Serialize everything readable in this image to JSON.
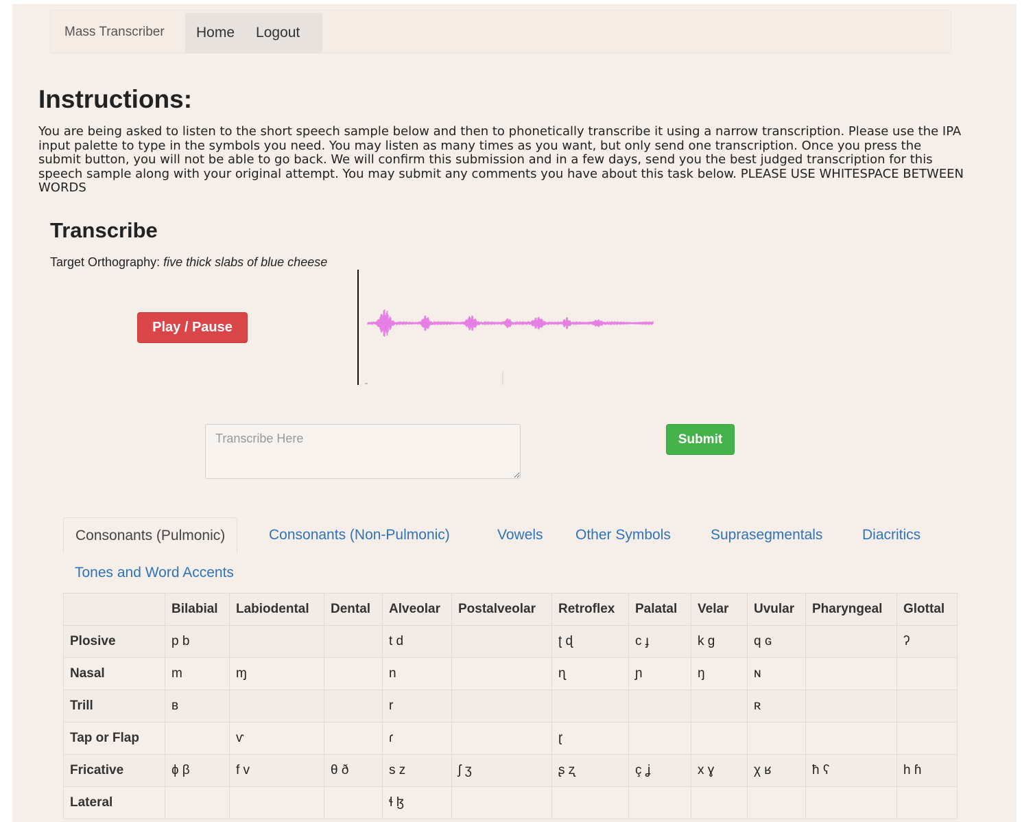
{
  "navbar": {
    "brand": "Mass Transcriber",
    "home": "Home",
    "logout": "Logout"
  },
  "instructions": {
    "heading": "Instructions:",
    "text": "You are being asked to listen to the short speech sample below and then to phonetically transcribe it using a narrow transcription. Please use the IPA input palette to type in the symbols you need. You may listen as many times as you want, but only send one transcription. Once you press the submit button, you will not be able to go back. We will confirm this submission and in a few days, send you the best judged transcription for this speech sample along with your original attempt. You may submit any comments you have about this task below. PLEASE USE WHITESPACE BETWEEN WORDS"
  },
  "transcribe": {
    "heading": "Transcribe",
    "target_label": "Target Orthography: ",
    "target_value": "five thick slabs of blue cheese",
    "play_label": "Play / Pause",
    "input_placeholder": "Transcribe Here",
    "submit_label": "Submit"
  },
  "colors": {
    "waveform": "#e57fe4",
    "play_button": "#d9464a",
    "submit_button": "#46b24b",
    "tab_link": "#2f73b8"
  },
  "tabs": [
    {
      "label": "Consonants (Pulmonic)",
      "active": true
    },
    {
      "label": "Consonants (Non-Pulmonic)",
      "active": false
    },
    {
      "label": "Vowels",
      "active": false
    },
    {
      "label": "Other Symbols",
      "active": false
    },
    {
      "label": "Suprasegmentals",
      "active": false
    },
    {
      "label": "Diacritics",
      "active": false
    },
    {
      "label": "Tones and Word Accents",
      "active": false
    }
  ],
  "ipa_table": {
    "columns": [
      "",
      "Bilabial",
      "Labiodental",
      "Dental",
      "Alveolar",
      "Postalveolar",
      "Retroflex",
      "Palatal",
      "Velar",
      "Uvular",
      "Pharyngeal",
      "Glottal"
    ],
    "rows": [
      {
        "label": "Plosive",
        "cells": [
          "p b",
          "",
          "",
          "t d",
          "",
          "ʈ ɖ",
          "c ɟ",
          "k g",
          "q ɢ",
          "",
          "ʔ"
        ]
      },
      {
        "label": "Nasal",
        "cells": [
          "m",
          "ɱ",
          "",
          "n",
          "",
          "ɳ",
          "ɲ",
          "ŋ",
          "ɴ",
          "",
          ""
        ]
      },
      {
        "label": "Trill",
        "cells": [
          "ʙ",
          "",
          "",
          "r",
          "",
          "",
          "",
          "",
          "ʀ",
          "",
          ""
        ]
      },
      {
        "label": "Tap or Flap",
        "cells": [
          "",
          "ⱱ",
          "",
          "ɾ",
          "",
          "ɽ",
          "",
          "",
          "",
          "",
          ""
        ]
      },
      {
        "label": "Fricative",
        "cells": [
          "ɸ β",
          "f v",
          "θ ð",
          "s z",
          "ʃ ʒ",
          "ʂ ʐ",
          "ç ʝ",
          "x ɣ",
          "χ ʁ",
          "ħ ʕ",
          "h ɦ"
        ]
      },
      {
        "label": "Lateral",
        "cells": [
          "",
          "",
          "",
          "ɬ ɮ",
          "",
          "",
          "",
          "",
          "",
          "",
          ""
        ]
      }
    ]
  }
}
